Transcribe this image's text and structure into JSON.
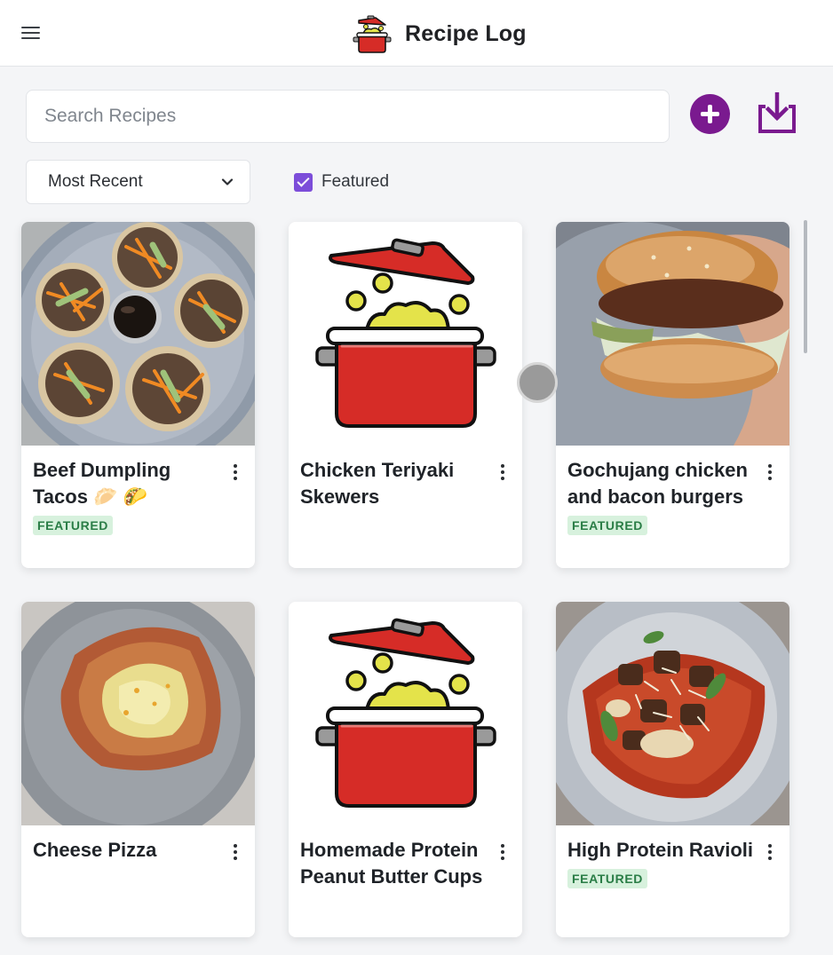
{
  "header": {
    "title": "Recipe Log",
    "menu_icon": "hamburger-menu-icon",
    "logo_icon": "cooking-pot-icon"
  },
  "toolbar": {
    "search_placeholder": "Search Recipes",
    "search_value": "",
    "add_icon": "plus-circle-icon",
    "download_icon": "download-tray-icon"
  },
  "filters": {
    "sort_selected": "Most Recent",
    "featured_label": "Featured",
    "featured_checked": true
  },
  "recipes": [
    {
      "title": "Beef Dumpling Tacos 🥟 🌮",
      "featured": true,
      "featured_label": "FEATURED",
      "image": "tacos-photo"
    },
    {
      "title": "Chicken Teriyaki Skewers",
      "featured": false,
      "image": "cooking-pot-placeholder"
    },
    {
      "title": "Gochujang chicken and bacon burgers",
      "featured": true,
      "featured_label": "FEATURED",
      "image": "burger-photo"
    },
    {
      "title": "Cheese Pizza",
      "featured": false,
      "image": "pizza-photo"
    },
    {
      "title": "Homemade Protein Peanut Butter Cups",
      "featured": false,
      "image": "cooking-pot-placeholder"
    },
    {
      "title": "High Protein Ravioli",
      "featured": true,
      "featured_label": "FEATURED",
      "image": "ravioli-photo"
    }
  ],
  "colors": {
    "accent_purple": "#7a1a8f",
    "checkbox_purple": "#7c4dd9",
    "pot_red": "#d62c27",
    "badge_green_text": "#2a7d46",
    "badge_green_bg": "#d7f1dd",
    "background": "#f4f5f7"
  }
}
